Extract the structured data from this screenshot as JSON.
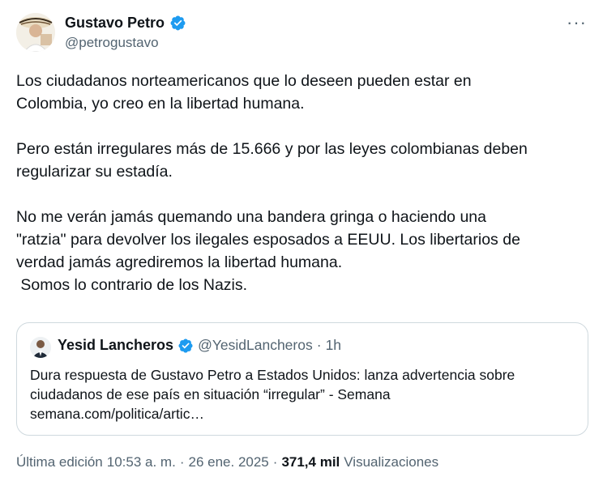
{
  "author": {
    "name": "Gustavo Petro",
    "handle": "@petrogustavo",
    "verified_color": "#1d9bf0"
  },
  "more_icon": "more-horizontal-icon",
  "more_glyph": "···",
  "tweet": {
    "paragraphs": [
      "Los ciudadanos norteamericanos que lo deseen pueden estar en\nColombia, yo creo en la libertad humana.",
      "Pero están irregulares más de 15.666 y por las leyes colombianas deben\nregularizar su estadía.",
      "No me verán jamás quemando una bandera gringa o haciendo una\n\"ratzia\" para devolver los ilegales esposados a EEUU. Los libertarios de\nverdad jamás agrediremos la libertad humana.\n Somos lo contrario de los Nazis."
    ]
  },
  "quote": {
    "name": "Yesid Lancheros",
    "handle": "@YesidLancheros",
    "dot": "·",
    "time": "1h",
    "lines": [
      "Dura respuesta de Gustavo Petro a Estados Unidos: lanza advertencia sobre",
      "ciudadanos de ese país en situación “irregular” - Semana",
      "semana.com/politica/artic…"
    ]
  },
  "meta": {
    "edited": "Última edición",
    "time": "10:53 a. m.",
    "sep1": "·",
    "date": "26 ene. 2025",
    "sep2": "·",
    "views_count": "371,4 mil",
    "views_label": "Visualizaciones"
  }
}
